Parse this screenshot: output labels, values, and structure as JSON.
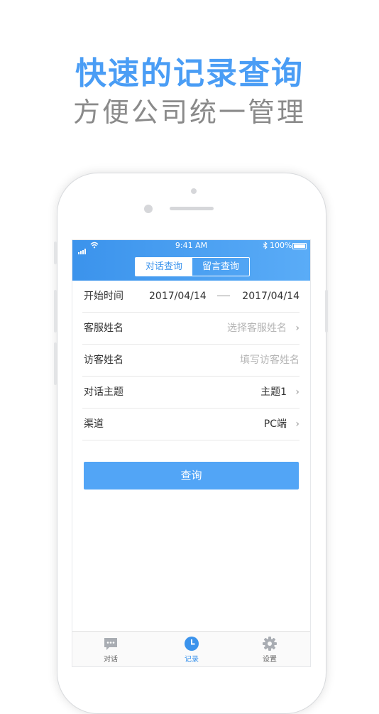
{
  "promo": {
    "title": "快速的记录查询",
    "subtitle": "方便公司统一管理"
  },
  "status_bar": {
    "time": "9:41 AM",
    "battery": "100%"
  },
  "segment": {
    "tabs": [
      {
        "label": "对话查询",
        "active": true
      },
      {
        "label": "留言查询",
        "active": false
      }
    ]
  },
  "form": {
    "start_time": {
      "label": "开始时间",
      "from": "2017/04/14",
      "to": "2017/04/14"
    },
    "agent_name": {
      "label": "客服姓名",
      "placeholder": "选择客服姓名"
    },
    "visitor_name": {
      "label": "访客姓名",
      "placeholder": "填写访客姓名"
    },
    "topic": {
      "label": "对话主题",
      "value": "主题1"
    },
    "channel": {
      "label": "渠道",
      "value": "PC端"
    }
  },
  "query_button": "查询",
  "tabbar": {
    "items": [
      {
        "label": "对话",
        "icon": "chat-bubble-icon",
        "active": false
      },
      {
        "label": "记录",
        "icon": "clock-icon",
        "active": true
      },
      {
        "label": "设置",
        "icon": "gear-icon",
        "active": false
      }
    ]
  },
  "colors": {
    "accent": "#3b93ec",
    "hero_title": "#4a9df5",
    "hero_subtitle": "#8a8a8a",
    "button": "#52a5f6"
  }
}
